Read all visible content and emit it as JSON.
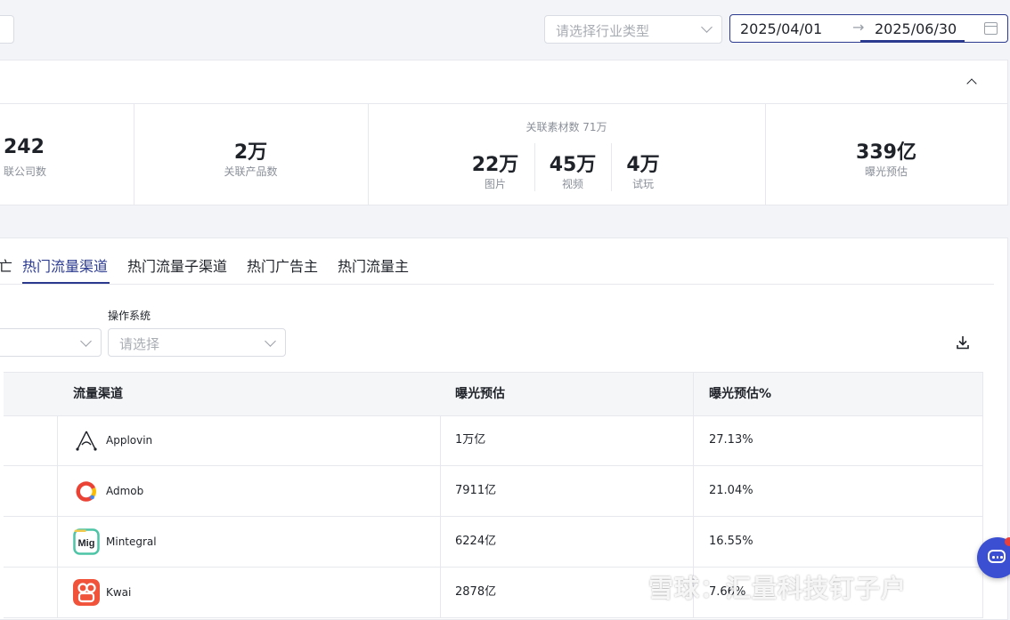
{
  "filters": {
    "industry_placeholder": "请选择行业类型",
    "date_start": "2025/04/01",
    "date_arrow": "→",
    "date_end": "2025/06/30"
  },
  "stats": {
    "companies": {
      "value": "242",
      "label": "联公司数"
    },
    "products": {
      "value": "2万",
      "label": "关联产品数"
    },
    "materials": {
      "header": "关联素材数  71万",
      "items": [
        {
          "value": "22万",
          "label": "图片"
        },
        {
          "value": "45万",
          "label": "视频"
        },
        {
          "value": "4万",
          "label": "试玩"
        }
      ]
    },
    "exposure": {
      "value": "339亿",
      "label": "曝光预估"
    }
  },
  "tabs": {
    "stub": "亡",
    "items": [
      "热门流量渠道",
      "热门流量子渠道",
      "热门广告主",
      "热门流量主"
    ],
    "active_index": 0
  },
  "filter2": {
    "os_label": "操作系统",
    "os_placeholder": "请选择"
  },
  "table": {
    "headers": [
      "流量渠道",
      "曝光预估",
      "曝光预估%"
    ],
    "rows": [
      {
        "channel": "Applovin",
        "exposure": "1万亿",
        "percent": "27.13%",
        "logo": "applovin-logo"
      },
      {
        "channel": "Admob",
        "exposure": "7911亿",
        "percent": "21.04%",
        "logo": "admob-logo"
      },
      {
        "channel": "Mintegral",
        "exposure": "6224亿",
        "percent": "16.55%",
        "logo": "mintegral-logo"
      },
      {
        "channel": "Kwai",
        "exposure": "2878亿",
        "percent": "7.66%",
        "logo": "kwai-logo"
      }
    ]
  },
  "watermark": "雪球：汇量科技钉子户",
  "colors": {
    "accent": "#2b3a8f",
    "chat": "#3a4fd1"
  }
}
